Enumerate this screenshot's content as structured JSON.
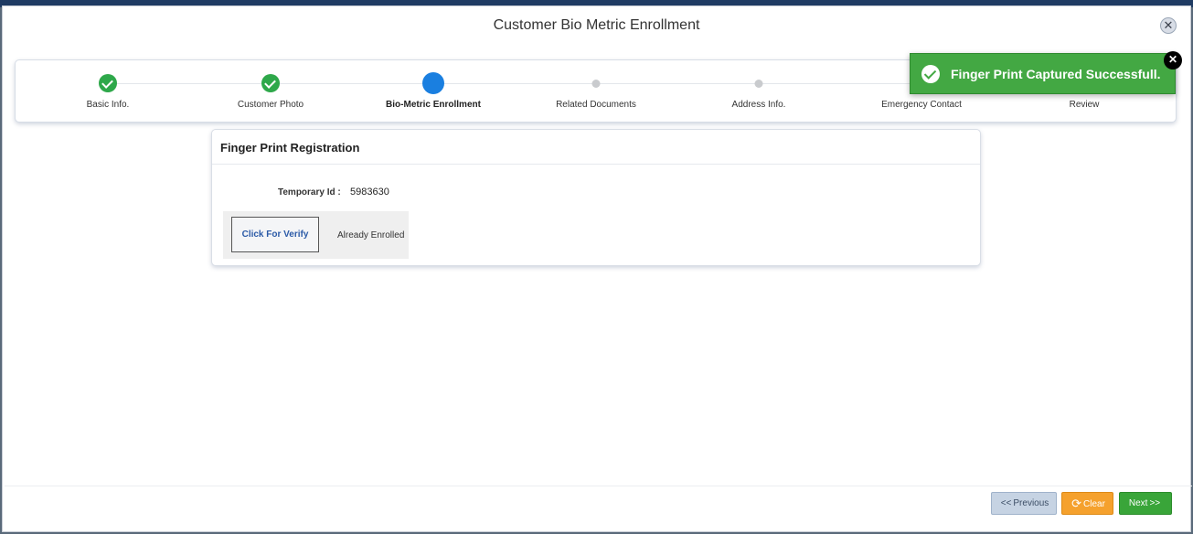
{
  "modal": {
    "title": "Customer Bio Metric Enrollment",
    "close_icon": "close-icon"
  },
  "steps": [
    {
      "label": "Basic Info.",
      "state": "done"
    },
    {
      "label": "Customer Photo",
      "state": "done"
    },
    {
      "label": "Bio-Metric Enrollment",
      "state": "active"
    },
    {
      "label": "Related Documents",
      "state": "pending"
    },
    {
      "label": "Address Info.",
      "state": "pending"
    },
    {
      "label": "Emergency Contact",
      "state": "pending"
    },
    {
      "label": "Review",
      "state": "pending"
    }
  ],
  "card": {
    "title": "Finger Print Registration",
    "temp_id_label": "Temporary Id :",
    "temp_id_value": "5983630",
    "verify_button": "Click For Verify",
    "status_text": "Already Enrolled"
  },
  "toast": {
    "message": "Finger Print Captured Successfull.",
    "icon": "check-circle-icon",
    "color": "#43a843"
  },
  "footer": {
    "previous_label": "Previous",
    "previous_icon": "<<",
    "clear_label": "Clear",
    "clear_icon": "refresh-icon",
    "next_label": "Next",
    "next_icon": ">>"
  },
  "colors": {
    "done": "#2ea84a",
    "active": "#1a7fe0",
    "pending": "#c9cbce"
  }
}
